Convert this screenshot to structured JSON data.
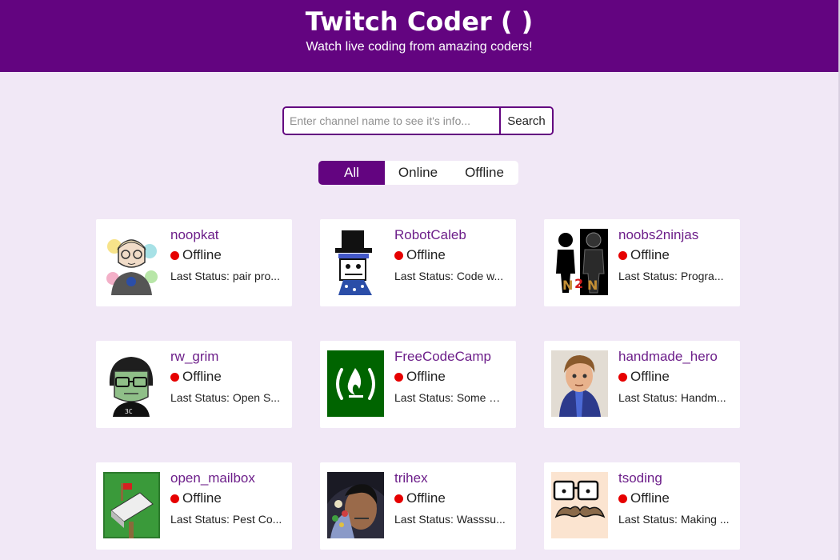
{
  "header": {
    "title": "Twitch Coder ( )",
    "subtitle": "Watch live coding from amazing coders!"
  },
  "search": {
    "placeholder": "Enter channel name to see it's info...",
    "button_label": "Search"
  },
  "filters": [
    {
      "label": "All",
      "active": true
    },
    {
      "label": "Online",
      "active": false
    },
    {
      "label": "Offline",
      "active": false
    }
  ],
  "colors": {
    "brand": "#630480",
    "offline_dot": "#e60000",
    "background": "#f1e8f6"
  },
  "channels": [
    {
      "name": "noopkat",
      "status": "Offline",
      "last_status": "Last Status: pair pro..."
    },
    {
      "name": "RobotCaleb",
      "status": "Offline",
      "last_status": "Last Status: Code w..."
    },
    {
      "name": "noobs2ninjas",
      "status": "Offline",
      "last_status": "Last Status: Progra..."
    },
    {
      "name": "rw_grim",
      "status": "Offline",
      "last_status": "Last Status: Open S..."
    },
    {
      "name": "FreeCodeCamp",
      "status": "Offline",
      "last_status": "Last Status: Some G..."
    },
    {
      "name": "handmade_hero",
      "status": "Offline",
      "last_status": "Last Status: Handm..."
    },
    {
      "name": "open_mailbox",
      "status": "Offline",
      "last_status": "Last Status: Pest Co..."
    },
    {
      "name": "trihex",
      "status": "Offline",
      "last_status": "Last Status: Wasssu..."
    },
    {
      "name": "tsoding",
      "status": "Offline",
      "last_status": "Last Status: Making ..."
    }
  ]
}
